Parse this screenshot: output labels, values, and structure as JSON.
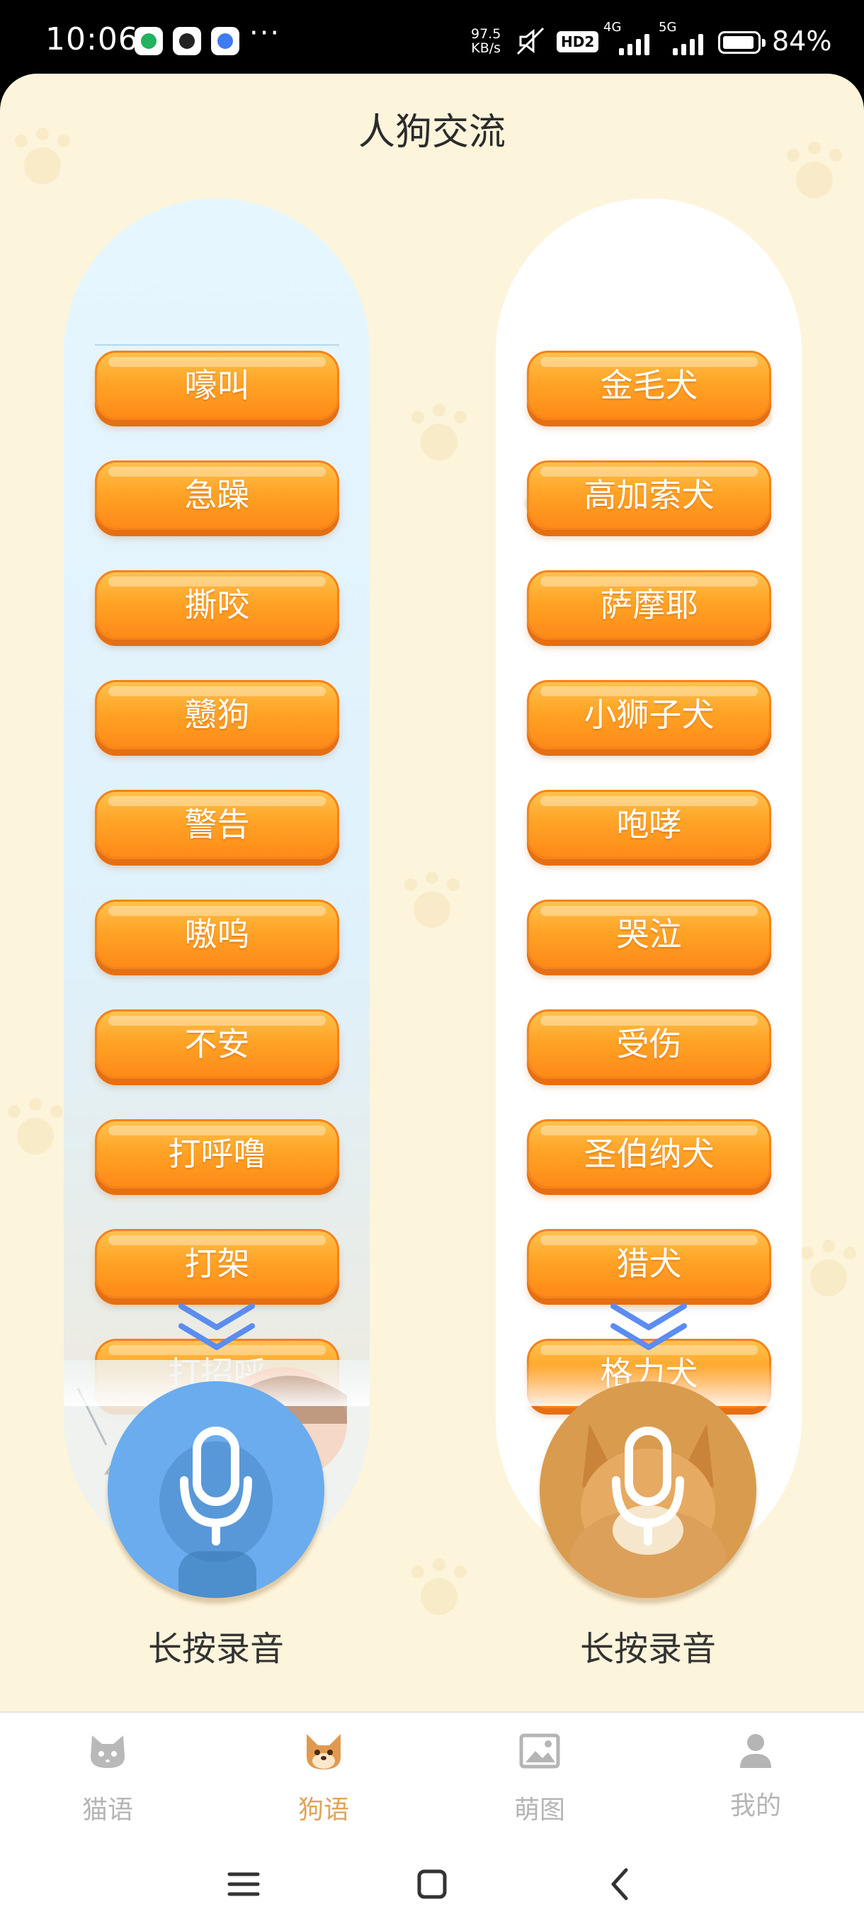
{
  "status_bar": {
    "time": "10:06",
    "overflow": "···",
    "net_speed_value": "97.5",
    "net_speed_unit": "KB/s",
    "hd_badge": "HD2",
    "net_4g": "4G",
    "net_5g": "5G",
    "battery_text": "84%",
    "battery_level": 0.84
  },
  "page": {
    "title": "人狗交流"
  },
  "left_column": {
    "items": [
      "嚎叫",
      "急躁",
      "撕咬",
      "戆狗",
      "警告",
      "嗷呜",
      "不安",
      "打呼噜",
      "打架",
      "打招呼"
    ],
    "record_label": "长按录音"
  },
  "right_column": {
    "items": [
      "金毛犬",
      "高加索犬",
      "萨摩耶",
      "小狮子犬",
      "咆哮",
      "哭泣",
      "受伤",
      "圣伯纳犬",
      "猎犬",
      "格力犬"
    ],
    "record_label": "长按录音"
  },
  "tabs": [
    {
      "label": "猫语",
      "icon": "cat-face-icon"
    },
    {
      "label": "狗语",
      "icon": "dog-face-icon",
      "active": true
    },
    {
      "label": "萌图",
      "icon": "image-icon"
    },
    {
      "label": "我的",
      "icon": "user-icon"
    }
  ],
  "colors": {
    "background": "#fdf4dc",
    "button_orange": "#ff9a22",
    "active_tab": "#e0a35a",
    "inactive_tab": "#b5b5b5",
    "chevron_blue": "#5b8cf0",
    "left_mic": "#6aacee",
    "right_mic": "#d99b4e"
  }
}
